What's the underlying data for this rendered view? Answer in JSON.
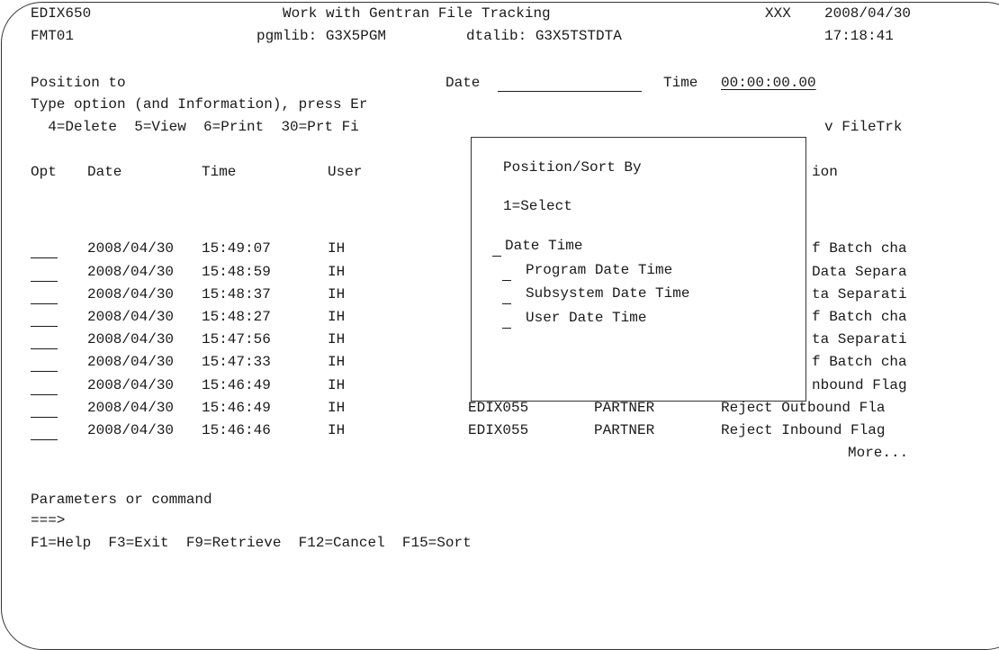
{
  "header": {
    "program_id": "EDIX650",
    "title": "Work with Gentran File Tracking",
    "system": "XXX",
    "date": "2008/04/30",
    "format": "FMT01",
    "pgmlib": "pgmlib: G3X5PGM",
    "dtalib": "dtalib: G3X5TSTDTA",
    "time": "17:18:41"
  },
  "position": {
    "label": "Position to",
    "date_label": "Date",
    "date_value": "",
    "time_label": "Time",
    "time_value": "00:00:00.00"
  },
  "instructions": {
    "line1": "Type option (and Information), press Er",
    "line2": "  4=Delete  5=View  6=Print  30=Prt Fi",
    "line2_tail": "v FileTrk"
  },
  "table": {
    "headers": {
      "opt": "Opt",
      "date": "Date",
      "time": "Time",
      "user": "User",
      "desc_tail": "ion"
    },
    "rows": [
      {
        "date": "2008/04/30",
        "time": "15:49:07",
        "user": "IH",
        "program": "",
        "profile": "",
        "desc": "f Batch cha"
      },
      {
        "date": "2008/04/30",
        "time": "15:48:59",
        "user": "IH",
        "program": "",
        "profile": "",
        "desc": "Data Separa"
      },
      {
        "date": "2008/04/30",
        "time": "15:48:37",
        "user": "IH",
        "program": "",
        "profile": "",
        "desc": "ta Separati"
      },
      {
        "date": "2008/04/30",
        "time": "15:48:27",
        "user": "IH",
        "program": "",
        "profile": "",
        "desc": "f Batch cha"
      },
      {
        "date": "2008/04/30",
        "time": "15:47:56",
        "user": "IH",
        "program": "",
        "profile": "",
        "desc": "ta Separati"
      },
      {
        "date": "2008/04/30",
        "time": "15:47:33",
        "user": "IH",
        "program": "",
        "profile": "",
        "desc": "f Batch cha"
      },
      {
        "date": "2008/04/30",
        "time": "15:46:49",
        "user": "IH",
        "program": "",
        "profile": "",
        "desc": "nbound Flag"
      },
      {
        "date": "2008/04/30",
        "time": "15:46:49",
        "user": "IH",
        "program": "EDIX055",
        "profile": "PARTNER",
        "desc": "Reject Outbound Fla"
      },
      {
        "date": "2008/04/30",
        "time": "15:46:46",
        "user": "IH",
        "program": "EDIX055",
        "profile": "PARTNER",
        "desc": "Reject Inbound Flag"
      }
    ],
    "more": "More..."
  },
  "command": {
    "label": "Parameters or command",
    "prompt": "===>",
    "value": ""
  },
  "function_keys": "F1=Help  F3=Exit  F9=Retrieve  F12=Cancel  F15=Sort",
  "popup": {
    "title": "Position/Sort By",
    "instruction": "1=Select",
    "options": [
      {
        "label": "Date Time",
        "value": ""
      },
      {
        "label": "Program Date Time",
        "value": ""
      },
      {
        "label": "Subsystem Date Time",
        "value": ""
      },
      {
        "label": "User Date Time",
        "value": ""
      }
    ]
  }
}
